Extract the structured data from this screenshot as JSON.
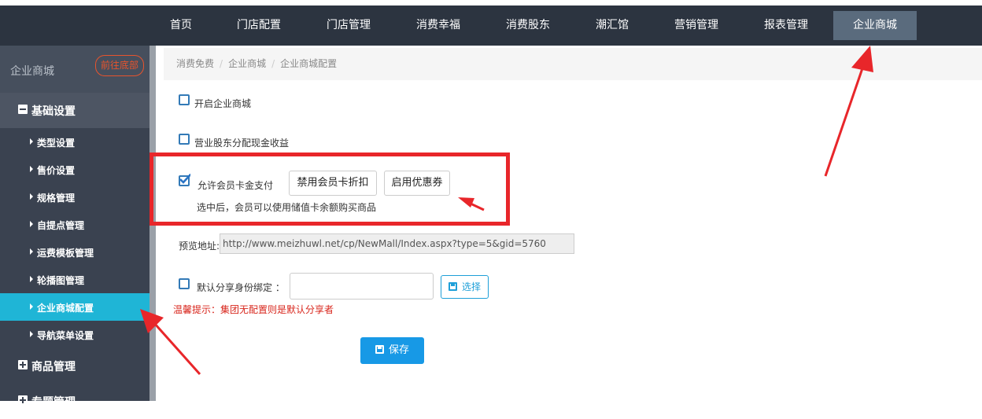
{
  "topnav": {
    "items": [
      "首页",
      "门店配置",
      "门店管理",
      "消费幸福",
      "消费股东",
      "潮汇馆",
      "营销管理",
      "报表管理",
      "企业商城"
    ],
    "active_index": 8
  },
  "sidebar": {
    "title": "企业商城",
    "goto_bottom": "前往底部",
    "group_basic": "基础设置",
    "sub_items": [
      "类型设置",
      "售价设置",
      "规格管理",
      "自提点管理",
      "运费模板管理",
      "轮播图管理",
      "企业商城配置",
      "导航菜单设置"
    ],
    "active_sub_index": 6,
    "group_goods": "商品管理",
    "group_special": "专题管理"
  },
  "breadcrumb": [
    "消费免费",
    "企业商城",
    "企业商城配置"
  ],
  "form": {
    "enable_mall": {
      "label": "开启企业商城",
      "checked": false
    },
    "shareholder_cash": {
      "label": "营业股东分配现金收益",
      "checked": false
    },
    "member_card_pay": {
      "label": "允许会员卡金支付",
      "checked": true,
      "hint": "选中后，会员可以使用储值卡余额购买商品"
    },
    "disable_discount_button": "禁用会员卡折扣",
    "enable_coupon_button": "启用优惠券",
    "preview_label": "预览地址:",
    "preview_url": "http://www.meizhuwl.net/cp/NewMall/Index.aspx?type=5&gid=5760",
    "default_share": {
      "label": "默认分享身份绑定 ：",
      "checked": false,
      "value": ""
    },
    "select_button": "选择",
    "tip": "温馨提示：集团无配置则是默认分享者",
    "save_button": "保存"
  },
  "colors": {
    "annotation_red": "#e8262a",
    "active_sub": "#1fb5d6",
    "primary_blue": "#1799e6"
  }
}
